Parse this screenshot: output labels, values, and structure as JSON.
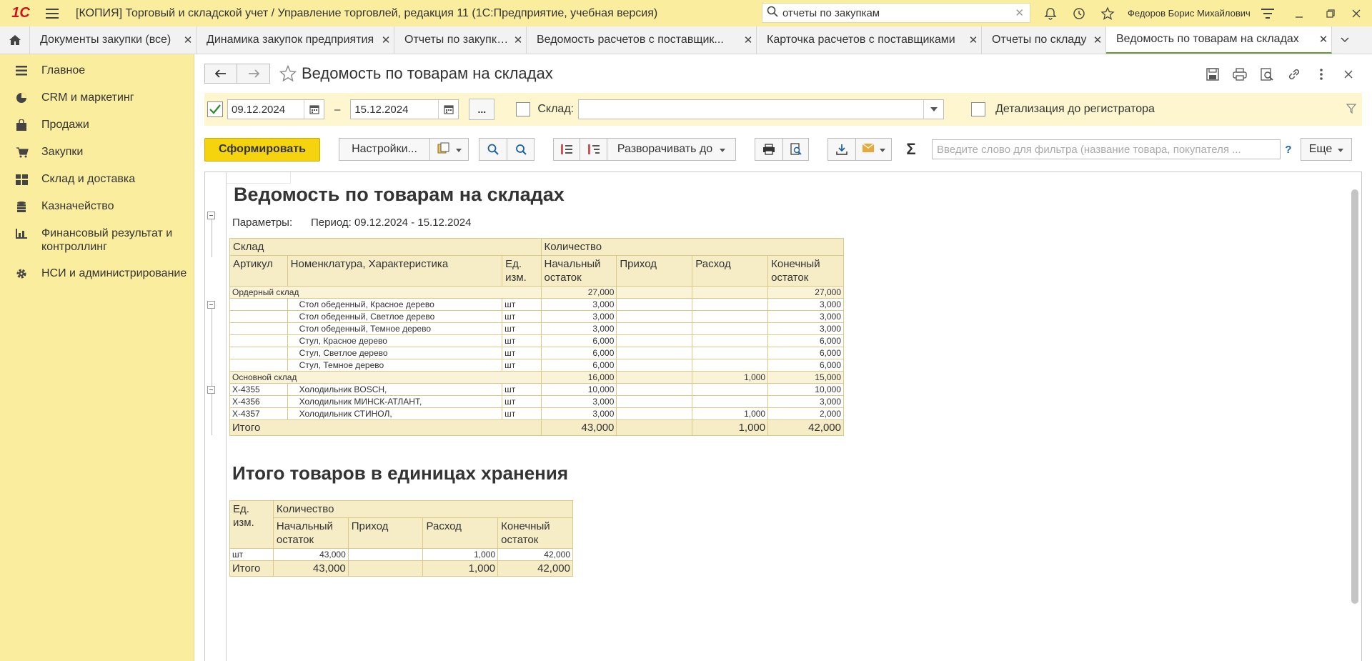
{
  "app": {
    "logo": "1С",
    "title": "[КОПИЯ] Торговый и складской учет / Управление торговлей, редакция 11  (1С:Предприятие, учебная версия)",
    "search_value": "отчеты по закупкам",
    "user": "Федоров Борис Михайлович"
  },
  "tabs": [
    {
      "label": "Документы закупки (все)"
    },
    {
      "label": "Динамика закупок предприятия"
    },
    {
      "label": "Отчеты по закупкам"
    },
    {
      "label": "Ведомость расчетов с поставщик..."
    },
    {
      "label": "Карточка расчетов с поставщиками"
    },
    {
      "label": "Отчеты по складу"
    },
    {
      "label": "Ведомость по товарам на складах"
    }
  ],
  "sidebar": {
    "items": [
      {
        "label": "Главное",
        "icon": "menu-lines-icon"
      },
      {
        "label": "CRM и маркетинг",
        "icon": "pie-chart-icon"
      },
      {
        "label": "Продажи",
        "icon": "shopping-bag-icon"
      },
      {
        "label": "Закупки",
        "icon": "cart-icon"
      },
      {
        "label": "Склад и доставка",
        "icon": "warehouse-icon"
      },
      {
        "label": "Казначейство",
        "icon": "coins-icon"
      },
      {
        "label": "Финансовый результат и контроллинг",
        "icon": "bar-chart-icon"
      },
      {
        "label": "НСИ и администрирование",
        "icon": "gear-icon"
      }
    ]
  },
  "page": {
    "title": "Ведомость по товарам на складах"
  },
  "params": {
    "date_from": "09.12.2024",
    "dash": "–",
    "date_to": "15.12.2024",
    "ellipsis": "...",
    "warehouse_label": "Склад:",
    "warehouse_value": "",
    "detail_label": "Детализация до регистратора"
  },
  "toolbar": {
    "generate": "Сформировать",
    "settings": "Настройки...",
    "expand_to": "Разворачивать до",
    "filter_placeholder": "Введите слово для фильтра (название товара, покупателя ...",
    "help": "?",
    "more": "Еще"
  },
  "report": {
    "title": "Ведомость по товарам на складах",
    "params_label": "Параметры:",
    "params_value": "Период: 09.12.2024 - 15.12.2024",
    "headers": {
      "warehouse": "Склад",
      "quantity": "Количество",
      "article": "Артикул",
      "nomenclature": "Номенклатура, Характеристика",
      "unit": "Ед. изм.",
      "start": "Начальный остаток",
      "income": "Приход",
      "expense": "Расход",
      "end": "Конечный остаток"
    },
    "groups": [
      {
        "name": "Ордерный склад",
        "start": "27,000",
        "income": "",
        "expense": "",
        "end": "27,000",
        "rows": [
          {
            "article": "",
            "name": "Стол обеденный, Красное дерево",
            "unit": "шт",
            "start": "3,000",
            "income": "",
            "expense": "",
            "end": "3,000"
          },
          {
            "article": "",
            "name": "Стол обеденный, Светлое дерево",
            "unit": "шт",
            "start": "3,000",
            "income": "",
            "expense": "",
            "end": "3,000"
          },
          {
            "article": "",
            "name": "Стол обеденный, Темное дерево",
            "unit": "шт",
            "start": "3,000",
            "income": "",
            "expense": "",
            "end": "3,000"
          },
          {
            "article": "",
            "name": "Стул, Красное дерево",
            "unit": "шт",
            "start": "6,000",
            "income": "",
            "expense": "",
            "end": "6,000"
          },
          {
            "article": "",
            "name": "Стул, Светлое дерево",
            "unit": "шт",
            "start": "6,000",
            "income": "",
            "expense": "",
            "end": "6,000"
          },
          {
            "article": "",
            "name": "Стул, Темное дерево",
            "unit": "шт",
            "start": "6,000",
            "income": "",
            "expense": "",
            "end": "6,000"
          }
        ]
      },
      {
        "name": "Основной склад",
        "start": "16,000",
        "income": "",
        "expense": "1,000",
        "end": "15,000",
        "rows": [
          {
            "article": "X-4355",
            "name": "Холодильник BOSCH,",
            "unit": "шт",
            "start": "10,000",
            "income": "",
            "expense": "",
            "end": "10,000"
          },
          {
            "article": "X-4356",
            "name": "Холодильник МИНСК-АТЛАНТ,",
            "unit": "шт",
            "start": "3,000",
            "income": "",
            "expense": "",
            "end": "3,000"
          },
          {
            "article": "X-4357",
            "name": "Холодильник СТИНОЛ,",
            "unit": "шт",
            "start": "3,000",
            "income": "",
            "expense": "1,000",
            "end": "2,000"
          }
        ]
      }
    ],
    "total": {
      "label": "Итого",
      "start": "43,000",
      "income": "",
      "expense": "1,000",
      "end": "42,000"
    },
    "units_title": "Итого товаров в единицах хранения",
    "units_headers": {
      "unit": "Ед. изм.",
      "quantity": "Количество",
      "start": "Начальный остаток",
      "income": "Приход",
      "expense": "Расход",
      "end": "Конечный остаток"
    },
    "units_row": {
      "unit": "шт",
      "start": "43,000",
      "income": "",
      "expense": "1,000",
      "end": "42,000"
    },
    "units_total": {
      "label": "Итого",
      "start": "43,000",
      "income": "",
      "expense": "1,000",
      "end": "42,000"
    }
  }
}
